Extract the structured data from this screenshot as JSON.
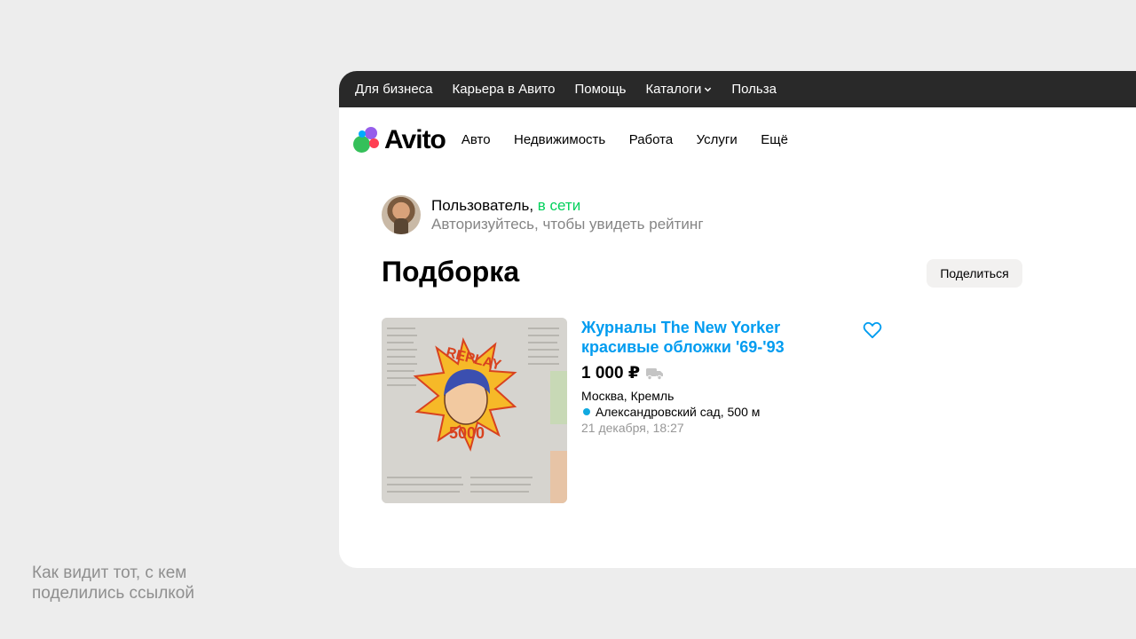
{
  "caption": {
    "line1": "Как видит тот, с кем",
    "line2": "поделились ссылкой"
  },
  "topbar": {
    "links": [
      "Для бизнеса",
      "Карьера в Авито",
      "Помощь",
      "Каталоги",
      "Польза"
    ]
  },
  "header": {
    "logo_text": "Avito",
    "nav": [
      "Авто",
      "Недвижимость",
      "Работа",
      "Услуги",
      "Ещё"
    ]
  },
  "profile": {
    "name": "Пользователь,",
    "status": "в сети",
    "hint": "Авторизуйтесь, чтобы увидеть рейтинг"
  },
  "page": {
    "title": "Подборка",
    "share_label": "Поделиться"
  },
  "item": {
    "title_line1": "Журналы The New Yorker",
    "title_line2": "красивые обложки '69-'93",
    "price": "1 000 ₽",
    "address": "Москва, Кремль",
    "metro": "Александровский сад, 500 м",
    "date": "21 декабря, 18:27"
  },
  "colors": {
    "link_blue": "#009cf0",
    "online_green": "#02d15c",
    "metro_blue": "#10a9e0",
    "topbar_bg": "#292929"
  }
}
